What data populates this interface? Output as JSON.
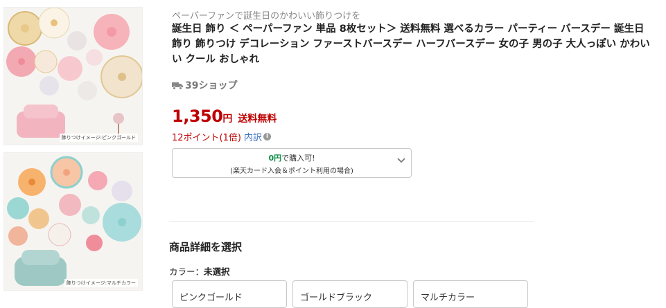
{
  "thumbnails": [
    {
      "caption": "飾りつけイメージ:ピンクゴールド"
    },
    {
      "caption": "飾りつけイメージ:マルチカラー"
    }
  ],
  "product": {
    "subtitle": "ペーパーファンで誕生日のかわいい飾りつけを",
    "title": "誕生日 飾り ＜ ペーパーファン 単品 8枚セット＞ 送料無料 選べるカラー パーティー バースデー 誕生日 飾り 飾りつけ デコレーション ファーストバースデー ハーフバースデー 女の子 男の子 大人っぽい かわいい クール おしゃれ",
    "shop_icon": "truck-icon",
    "shop_name": "39ショップ",
    "price": "1,350",
    "price_unit": "円",
    "shipping": "送料無料",
    "points": "12ポイント(1倍)",
    "breakdown": "内訳",
    "card_offer_amount": "0円",
    "card_offer_suffix": "で購入可!",
    "card_offer_note": "(楽天カード入会＆ポイント利用の場合)"
  },
  "selection": {
    "section_title": "商品詳細を選択",
    "color_label": "カラー：",
    "color_value": "未選択",
    "options": [
      "ピンクゴールド",
      "ゴールドブラック",
      "マルチカラー"
    ]
  },
  "colors": {
    "price_red": "#bf0000",
    "link_blue": "#3f73c6",
    "offer_green": "#0a8f45"
  }
}
